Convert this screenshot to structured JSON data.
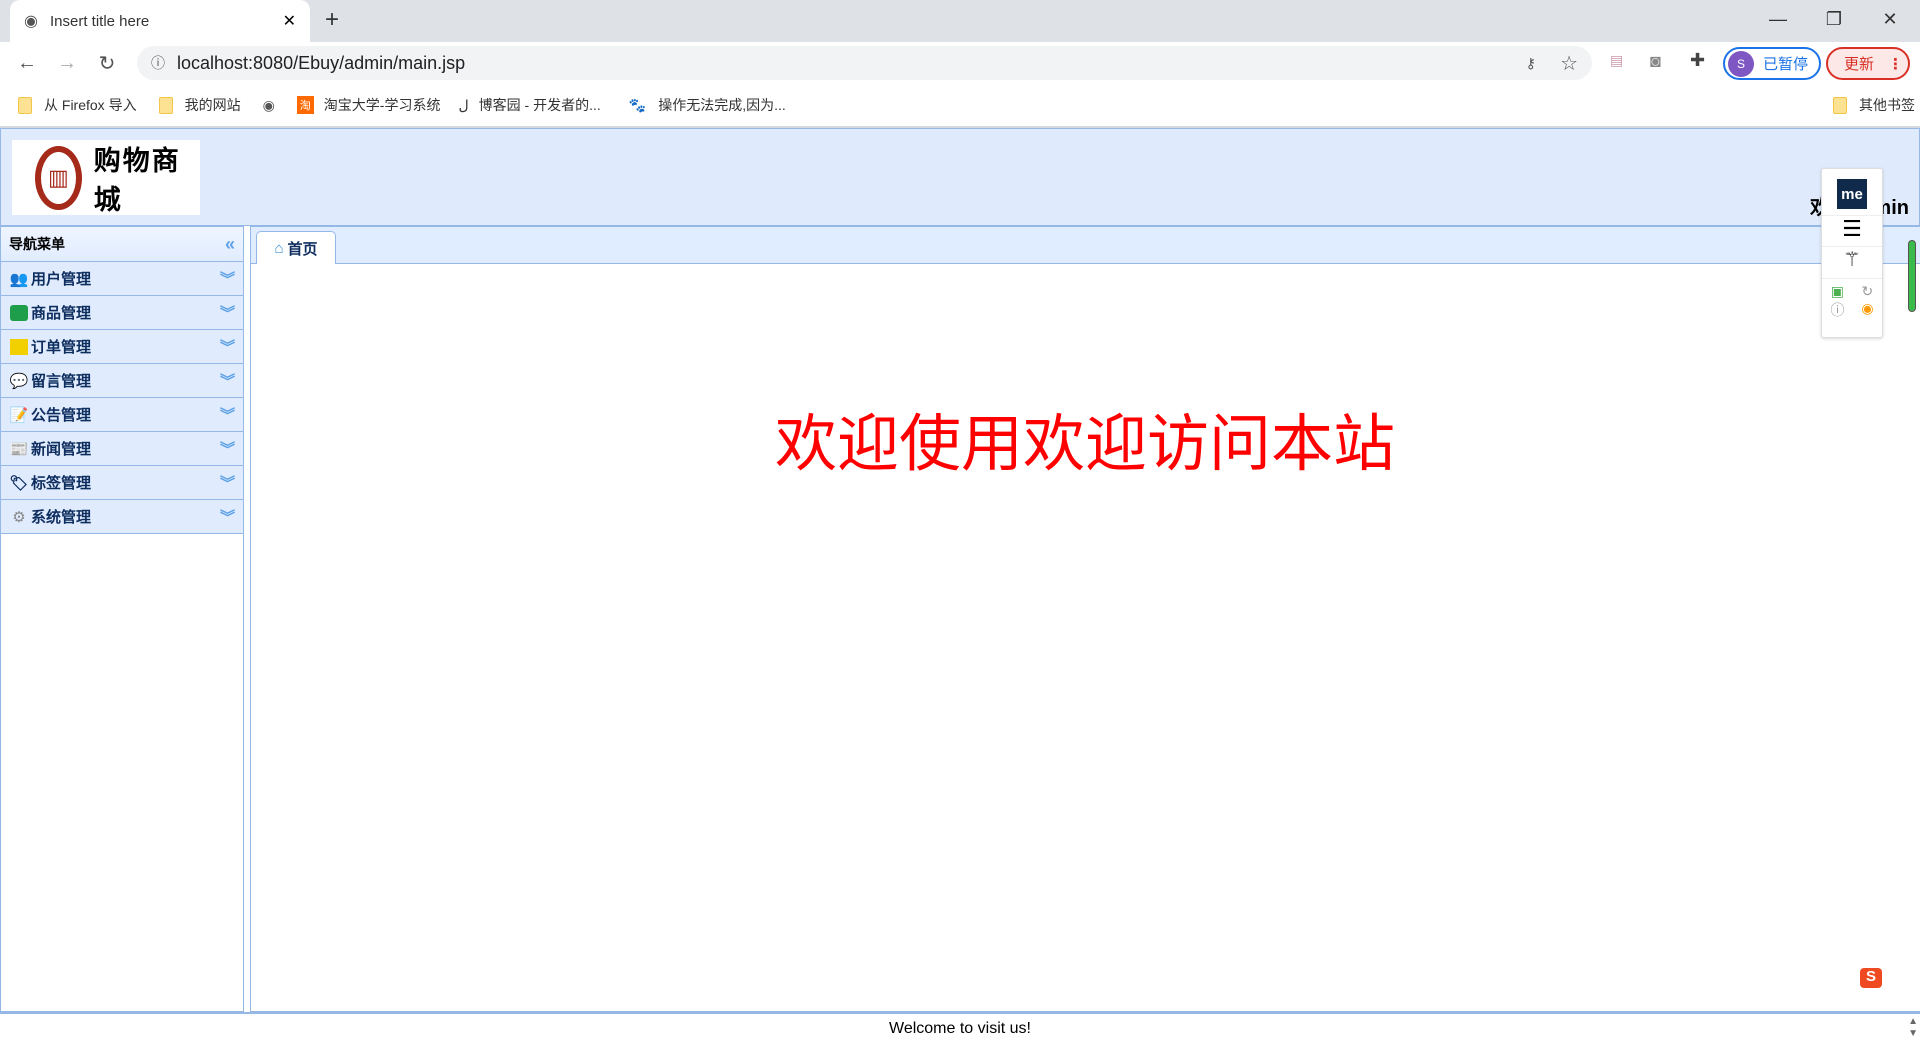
{
  "browser": {
    "tab_title": "Insert title here",
    "url": "localhost:8080/Ebuy/admin/main.jsp",
    "profile_initial": "S",
    "profile_status": "已暂停",
    "update_label": "更新",
    "bookmarks": [
      "从 Firefox 导入",
      "我的网站",
      "淘宝大学-学习系统",
      "博客园 - 开发者的...",
      "操作无法完成,因为..."
    ],
    "other_bookmarks": "其他书签"
  },
  "header": {
    "logo_text": "购物商城",
    "welcome_user": "欢迎admin"
  },
  "sidebar": {
    "title": "导航菜单",
    "items": [
      {
        "label": "用户管理",
        "icon": "users-icon"
      },
      {
        "label": "商品管理",
        "icon": "list-icon"
      },
      {
        "label": "订单管理",
        "icon": "book-icon"
      },
      {
        "label": "留言管理",
        "icon": "chat-bubble-icon"
      },
      {
        "label": "公告管理",
        "icon": "notepad-icon"
      },
      {
        "label": "新闻管理",
        "icon": "newspaper-icon"
      },
      {
        "label": "标签管理",
        "icon": "tag-icon"
      },
      {
        "label": "系统管理",
        "icon": "gear-icon"
      }
    ]
  },
  "main": {
    "tab_label": "首页",
    "welcome": "欢迎使用欢迎访问本站",
    "welcome_color": "#ff0000"
  },
  "footer": {
    "text": "Welcome to visit us!"
  },
  "extension": {
    "logo": "me"
  }
}
